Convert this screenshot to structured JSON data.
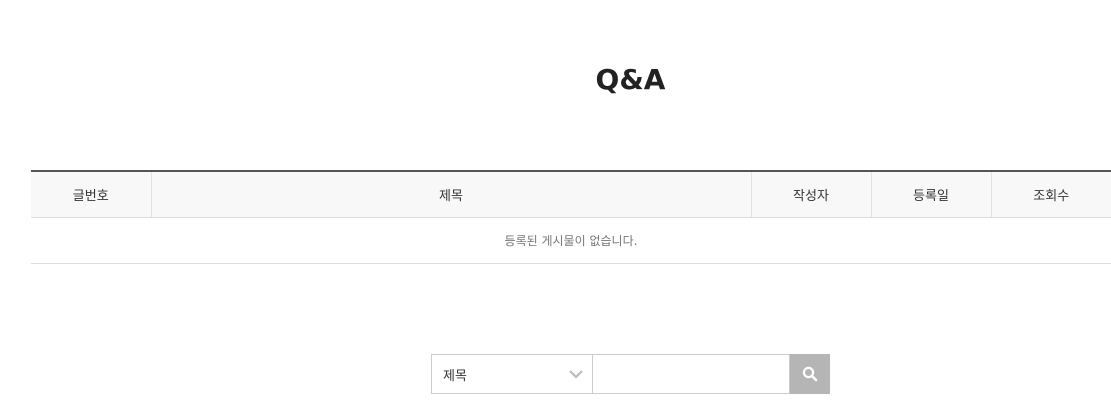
{
  "page": {
    "title": "Q&A"
  },
  "table": {
    "columns": [
      "글번호",
      "제목",
      "작성자",
      "등록일",
      "조회수"
    ],
    "empty_message": "등록된 게시물이 없습니다."
  },
  "search": {
    "field_selected": "제목",
    "field_options": [
      "제목"
    ],
    "query_value": "",
    "button_icon": "search-icon",
    "button_color": "#b5b5b5"
  }
}
